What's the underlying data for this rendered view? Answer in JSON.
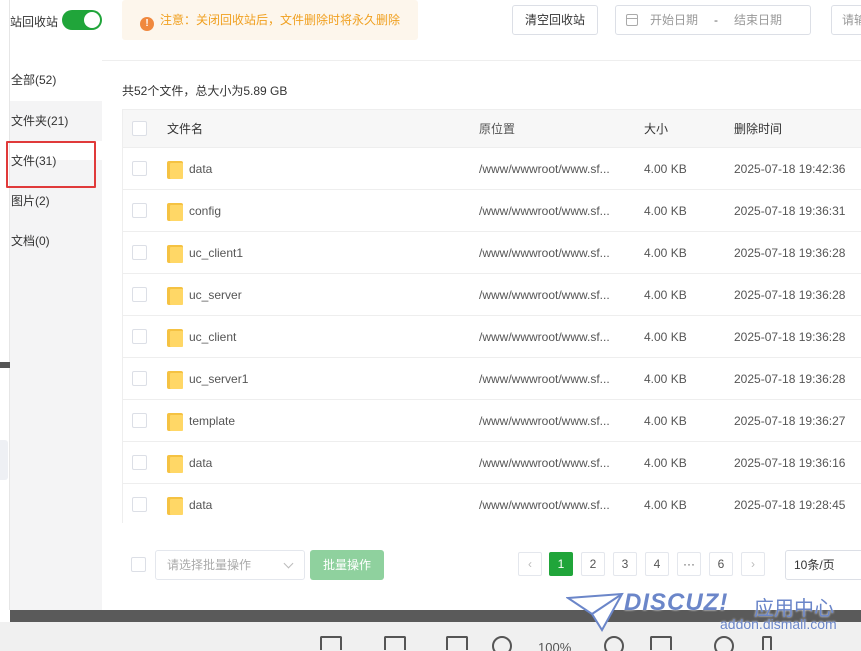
{
  "sidebar": {
    "toggle_label": "‌‌站回收站",
    "toggle_on": true,
    "items": [
      {
        "label": "全部(52)"
      },
      {
        "label": "文件夹(21)"
      },
      {
        "label": "文件(31)"
      },
      {
        "label": "图片(2)"
      },
      {
        "label": "文档(0)"
      }
    ]
  },
  "header": {
    "notice": "注意：关闭回收站后，文件删除时将永久删除",
    "clear_button": "清空回收站",
    "date_start_placeholder": "开始日期",
    "date_separator": "-",
    "date_end_placeholder": "结束日期",
    "search_placeholder": "请输"
  },
  "summary": "共52个文件，总大小为5.89 GB",
  "table": {
    "columns": [
      "文件名",
      "原位置",
      "大小",
      "删除时间"
    ],
    "rows": [
      {
        "name": "data",
        "location": "/www/wwwroot/www.sf...",
        "size": "4.00 KB",
        "time": "2025-07-18 19:42:36"
      },
      {
        "name": "config",
        "location": "/www/wwwroot/www.sf...",
        "size": "4.00 KB",
        "time": "2025-07-18 19:36:31"
      },
      {
        "name": "uc_client1",
        "location": "/www/wwwroot/www.sf...",
        "size": "4.00 KB",
        "time": "2025-07-18 19:36:28"
      },
      {
        "name": "uc_server",
        "location": "/www/wwwroot/www.sf...",
        "size": "4.00 KB",
        "time": "2025-07-18 19:36:28"
      },
      {
        "name": "uc_client",
        "location": "/www/wwwroot/www.sf...",
        "size": "4.00 KB",
        "time": "2025-07-18 19:36:28"
      },
      {
        "name": "uc_server1",
        "location": "/www/wwwroot/www.sf...",
        "size": "4.00 KB",
        "time": "2025-07-18 19:36:28"
      },
      {
        "name": "template",
        "location": "/www/wwwroot/www.sf...",
        "size": "4.00 KB",
        "time": "2025-07-18 19:36:27"
      },
      {
        "name": "data",
        "location": "/www/wwwroot/www.sf...",
        "size": "4.00 KB",
        "time": "2025-07-18 19:36:16"
      },
      {
        "name": "data",
        "location": "/www/wwwroot/www.sf...",
        "size": "4.00 KB",
        "time": "2025-07-18 19:28:45"
      }
    ]
  },
  "footer": {
    "batch_placeholder": "请选择批量操作",
    "batch_button": "批量操作",
    "pages": [
      "1",
      "2",
      "3",
      "4",
      "···",
      "6"
    ],
    "prev": "‹",
    "next": "›",
    "page_size": "10条/页"
  },
  "viewer": {
    "zoom": "100%"
  },
  "watermark": {
    "brand": "DISCUZ!",
    "cn": "应用中心",
    "url": "addon.dismall.com"
  },
  "colors": {
    "accent": "#20a53a",
    "warning": "#f0a020",
    "highlight_box": "#e03a3a"
  }
}
